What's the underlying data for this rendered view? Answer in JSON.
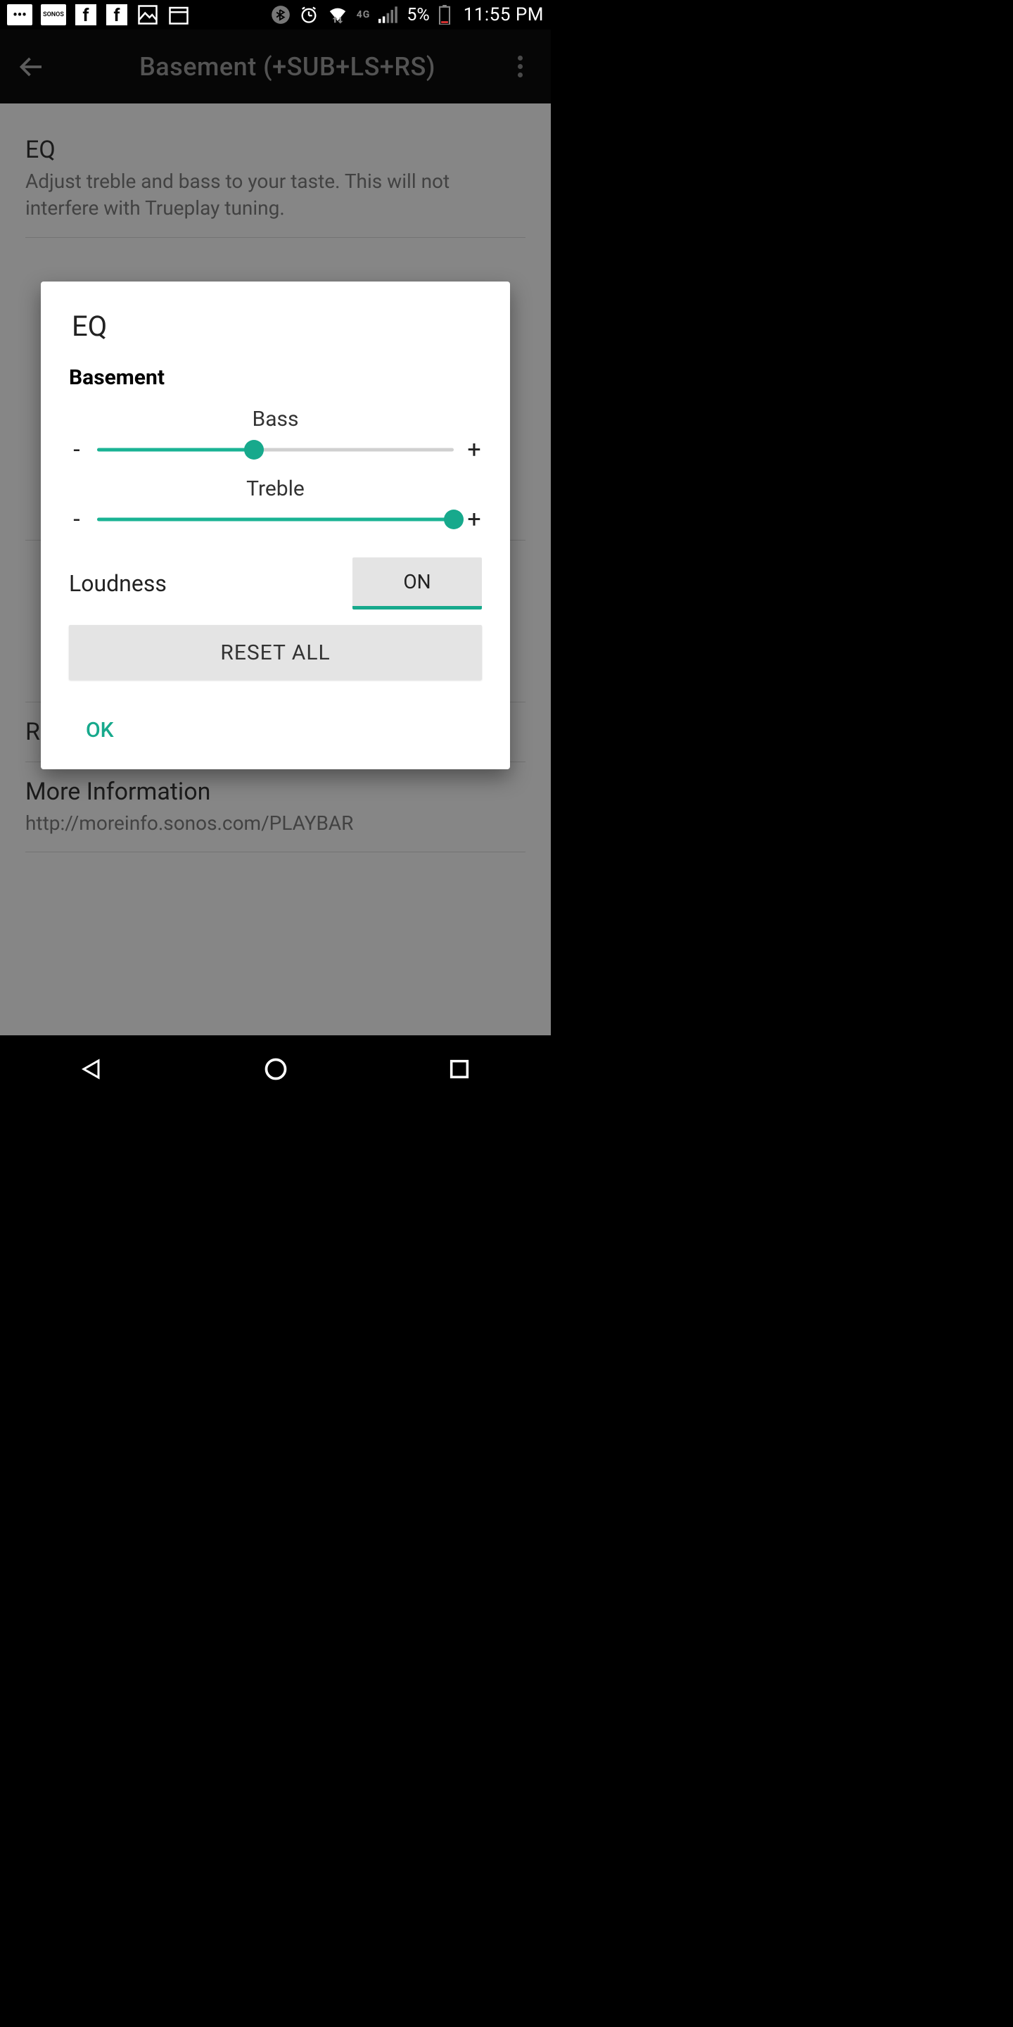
{
  "status": {
    "battery_pct": "5%",
    "time": "11:55 PM",
    "network_label": "4G"
  },
  "header": {
    "title": "Basement (+SUB+LS+RS)"
  },
  "settings": {
    "eq": {
      "title": "EQ",
      "desc": "Adjust treble and bass to your taste. This will not interfere with Trueplay tuning."
    },
    "remove_surrounds": "Remove Surrounds",
    "more_info_title": "More Information",
    "more_info_url": "http://moreinfo.sonos.com/PLAYBAR"
  },
  "modal": {
    "title": "EQ",
    "room": "Basement",
    "sliders": {
      "bass": {
        "label": "Bass",
        "percent": 44
      },
      "treble": {
        "label": "Treble",
        "percent": 100
      }
    },
    "minus": "-",
    "plus": "+",
    "loudness_label": "Loudness",
    "loudness_state": "ON",
    "reset_label": "RESET ALL",
    "ok_label": "OK"
  },
  "colors": {
    "accent": "#17a98c"
  }
}
